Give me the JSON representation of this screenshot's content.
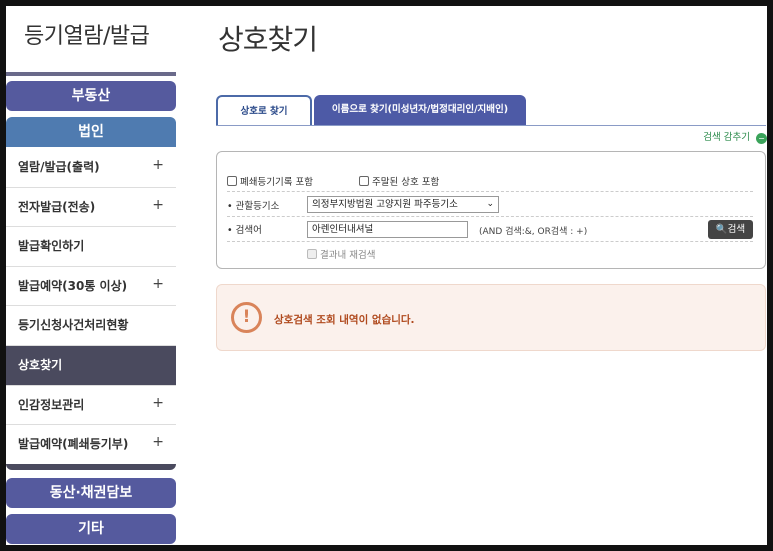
{
  "sidebar": {
    "title": "등기열람/발급",
    "categories": {
      "real_estate": "부동산",
      "corporation": "법인",
      "movable": "동산·채권담보",
      "etc": "기타"
    },
    "items": [
      {
        "label": "열람/발급(출력)",
        "plus": "+"
      },
      {
        "label": "전자발급(전송)",
        "plus": "+"
      },
      {
        "label": "발급확인하기",
        "plus": ""
      },
      {
        "label": "발급예약(30통 이상)",
        "plus": "+"
      },
      {
        "label": "등기신청사건처리현황",
        "plus": ""
      },
      {
        "label": "상호찾기",
        "plus": ""
      },
      {
        "label": "인감정보관리",
        "plus": "+"
      },
      {
        "label": "발급예약(폐쇄등기부)",
        "plus": "+"
      }
    ]
  },
  "main": {
    "title": "상호찾기",
    "tabs": [
      {
        "label": "상호로 찾기"
      },
      {
        "label": "이름으로 찾기(미성년자/법정대리인/지배인)"
      }
    ],
    "collapse_label": "검색 감추기",
    "collapse_icon": "−",
    "search": {
      "include_closed": "폐쇄등기기록 포함",
      "include_main_office": "주말된 상호 포함",
      "registry_label": "• 관할등기소",
      "registry_value": "의정부지방법원 고양지원 파주등기소",
      "keyword_label": "• 검색어",
      "keyword_value": "아렌인터내셔널",
      "hint": "(AND 검색:&, OR검색 : +)",
      "search_button": "검색",
      "refine_label": "결과내 재검색"
    },
    "notice": {
      "icon": "!",
      "text": "상호검색 조회 내역이 없습니다."
    }
  }
}
